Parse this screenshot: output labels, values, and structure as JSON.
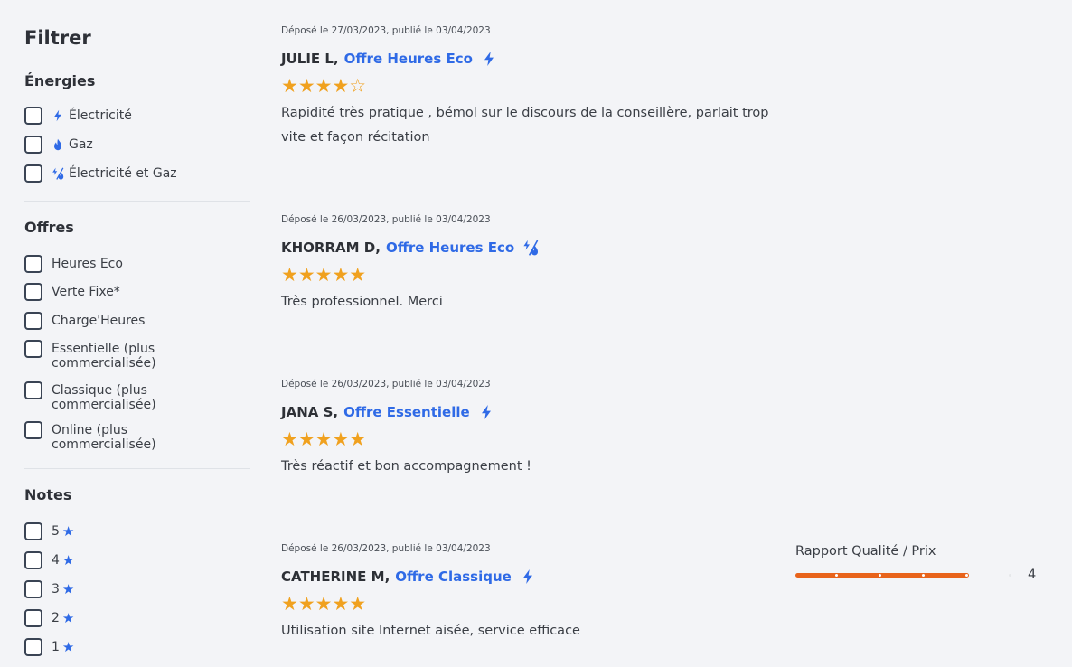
{
  "sidebar": {
    "title": "Filtrer",
    "energies": {
      "title": "Énergies",
      "items": [
        {
          "label": "Électricité",
          "icon": "bolt-icon"
        },
        {
          "label": "Gaz",
          "icon": "flame-icon"
        },
        {
          "label": "Électricité et Gaz",
          "icon": "bolt-flame-icon"
        }
      ]
    },
    "offres": {
      "title": "Offres",
      "items": [
        {
          "label": "Heures Eco"
        },
        {
          "label": "Verte Fixe*"
        },
        {
          "label": "Charge'Heures"
        },
        {
          "label": "Essentielle (plus",
          "label2": "commercialisée)"
        },
        {
          "label": "Classique (plus",
          "label2": "commercialisée)"
        },
        {
          "label": "Online (plus",
          "label2": "commercialisée)"
        }
      ]
    },
    "notes": {
      "title": "Notes",
      "items": [
        {
          "label": "5"
        },
        {
          "label": "4"
        },
        {
          "label": "3"
        },
        {
          "label": "2"
        },
        {
          "label": "1"
        }
      ]
    }
  },
  "reviews": [
    {
      "meta": "Déposé le 27/03/2023, publié le 03/04/2023",
      "name": "JULIE L,",
      "offer": "Offre Heures Eco",
      "energy_icon": "bolt-icon",
      "rating": 4,
      "stars": "★★★★☆",
      "comment": "Rapidité très pratique , bémol sur le discours de la conseillère, parlait trop vite et façon récitation"
    },
    {
      "meta": "Déposé le 26/03/2023, publié le 03/04/2023",
      "name": "KHORRAM D,",
      "offer": "Offre Heures Eco",
      "energy_icon": "bolt-flame-icon",
      "rating": 5,
      "stars": "★★★★★",
      "comment": "Très professionnel. Merci"
    },
    {
      "meta": "Déposé le 26/03/2023, publié le 03/04/2023",
      "name": "JANA S,",
      "offer": "Offre Essentielle",
      "energy_icon": "bolt-icon",
      "rating": 5,
      "stars": "★★★★★",
      "comment": "Très réactif et bon accompagnement !"
    },
    {
      "meta": "Déposé le 26/03/2023, publié le 03/04/2023",
      "name": "CATHERINE M,",
      "offer": "Offre Classique",
      "energy_icon": "bolt-icon",
      "rating": 5,
      "stars": "★★★★★",
      "comment": "Utilisation site Internet aisée, service efficace"
    }
  ],
  "rating_detail": {
    "label": "Rapport Qualité / Prix",
    "value": "4",
    "fraction": 0.8
  },
  "colors": {
    "accent_blue": "#2f6ae6",
    "star_orange": "#f0a11f",
    "bar_orange": "#e8631b",
    "background": "#f3f4f7"
  }
}
